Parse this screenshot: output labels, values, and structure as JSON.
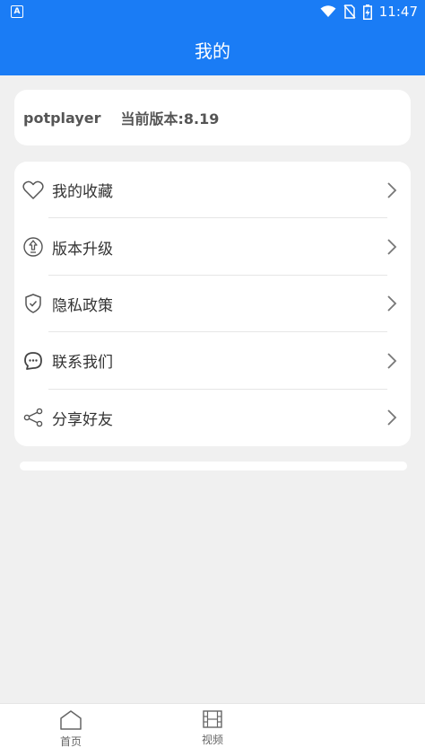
{
  "status_bar": {
    "app_indicator": "A",
    "time": "11:47",
    "icons": [
      "wifi-icon",
      "no-sim-icon",
      "battery-charging-icon"
    ]
  },
  "header": {
    "title": "我的"
  },
  "version_card": {
    "app_name": "potplayer",
    "version_text": "当前版本:8.19"
  },
  "menu": {
    "items": [
      {
        "label": "我的收藏",
        "icon": "heart-icon"
      },
      {
        "label": "版本升级",
        "icon": "upgrade-icon"
      },
      {
        "label": "隐私政策",
        "icon": "shield-check-icon"
      },
      {
        "label": "联系我们",
        "icon": "chat-bubble-icon"
      },
      {
        "label": "分享好友",
        "icon": "share-icon"
      }
    ]
  },
  "tabbar": {
    "tabs": [
      {
        "label": "首页",
        "icon": "home-icon"
      },
      {
        "label": "视频",
        "icon": "film-icon"
      }
    ]
  },
  "colors": {
    "accent": "#1a7cf5",
    "background": "#f0f0f0",
    "card": "#ffffff"
  }
}
